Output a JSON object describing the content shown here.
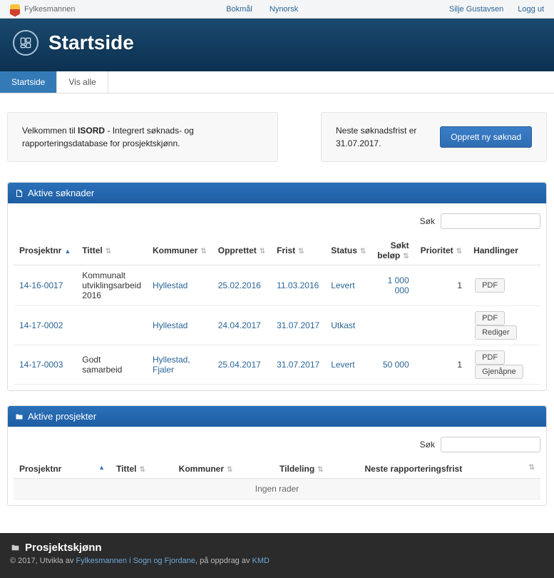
{
  "topbar": {
    "brand": "Fylkesmannen",
    "lang1": "Bokmål",
    "lang2": "Nynorsk",
    "user": "Silje Gustavsen",
    "logout": "Logg ut"
  },
  "hero": {
    "title": "Startside"
  },
  "tabs": {
    "start": "Startside",
    "all": "Vis alle"
  },
  "info": {
    "welcome_pre": "Velkommen til ",
    "welcome_strong": "ISORD",
    "welcome_post": " - Integrert søknads- og rapporteringsdatabase for prosjektskjønn.",
    "deadline": "Neste søknadsfrist er 31.07.2017.",
    "new_app": "Opprett ny søknad"
  },
  "panel1": {
    "title": "Aktive søknader",
    "search_label": "Søk",
    "cols": {
      "prosjektnr": "Prosjektnr",
      "tittel": "Tittel",
      "kommuner": "Kommuner",
      "opprettet": "Opprettet",
      "frist": "Frist",
      "status": "Status",
      "belop": "Søkt beløp",
      "prioritet": "Prioritet",
      "handlinger": "Handlinger"
    },
    "rows": [
      {
        "nr": "14-16-0017",
        "tittel": "Kommunalt utviklingsarbeid 2016",
        "kommuner": "Hyllestad",
        "opprettet": "25.02.2016",
        "frist": "11.03.2016",
        "status": "Levert",
        "belop": "1 000 000",
        "prioritet": "1",
        "b1": "PDF"
      },
      {
        "nr": "14-17-0002",
        "tittel": "",
        "kommuner": "Hyllestad",
        "opprettet": "24.04.2017",
        "frist": "31.07.2017",
        "status": "Utkast",
        "belop": "",
        "prioritet": "",
        "b1": "PDF",
        "b2": "Rediger"
      },
      {
        "nr": "14-17-0003",
        "tittel": "Godt samarbeid",
        "kommuner": "Hyllestad, Fjaler",
        "opprettet": "25.04.2017",
        "frist": "31.07.2017",
        "status": "Levert",
        "belop": "50 000",
        "prioritet": "1",
        "b1": "PDF",
        "b2": "Gjenåpne"
      }
    ]
  },
  "panel2": {
    "title": "Aktive prosjekter",
    "search_label": "Søk",
    "cols": {
      "prosjektnr": "Prosjektnr",
      "tittel": "Tittel",
      "kommuner": "Kommuner",
      "tildeling": "Tildeling",
      "neste": "Neste rapporteringsfrist"
    },
    "empty": "Ingen rader"
  },
  "footer": {
    "title": "Prosjektskjønn",
    "sub_pre": "© 2017, Utvikla av ",
    "sub_link1": "Fylkesmannen i Sogn og Fjordane",
    "sub_mid": ", på oppdrag av ",
    "sub_link2": "KMD"
  }
}
